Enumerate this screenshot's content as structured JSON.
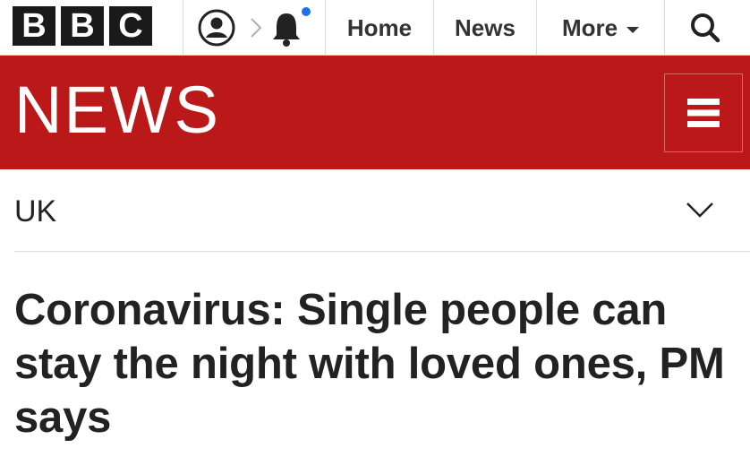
{
  "masthead": {
    "logo_letters": [
      "B",
      "B",
      "C"
    ],
    "icons": {
      "account": "account-icon",
      "chevron": "chevron-right-icon",
      "notifications": "bell-icon",
      "search": "search-icon"
    },
    "notification_dot_color": "#1a73e8",
    "nav": {
      "home_label": "Home",
      "news_label": "News",
      "more_label": "More"
    }
  },
  "banner": {
    "wordmark": "NEWS",
    "color": "#bb1919",
    "menu_icon": "hamburger-icon"
  },
  "section": {
    "label": "UK",
    "dropdown_icon": "chevron-down-icon"
  },
  "article": {
    "headline": "Coronavirus: Single people can stay the night with loved ones, PM says"
  }
}
